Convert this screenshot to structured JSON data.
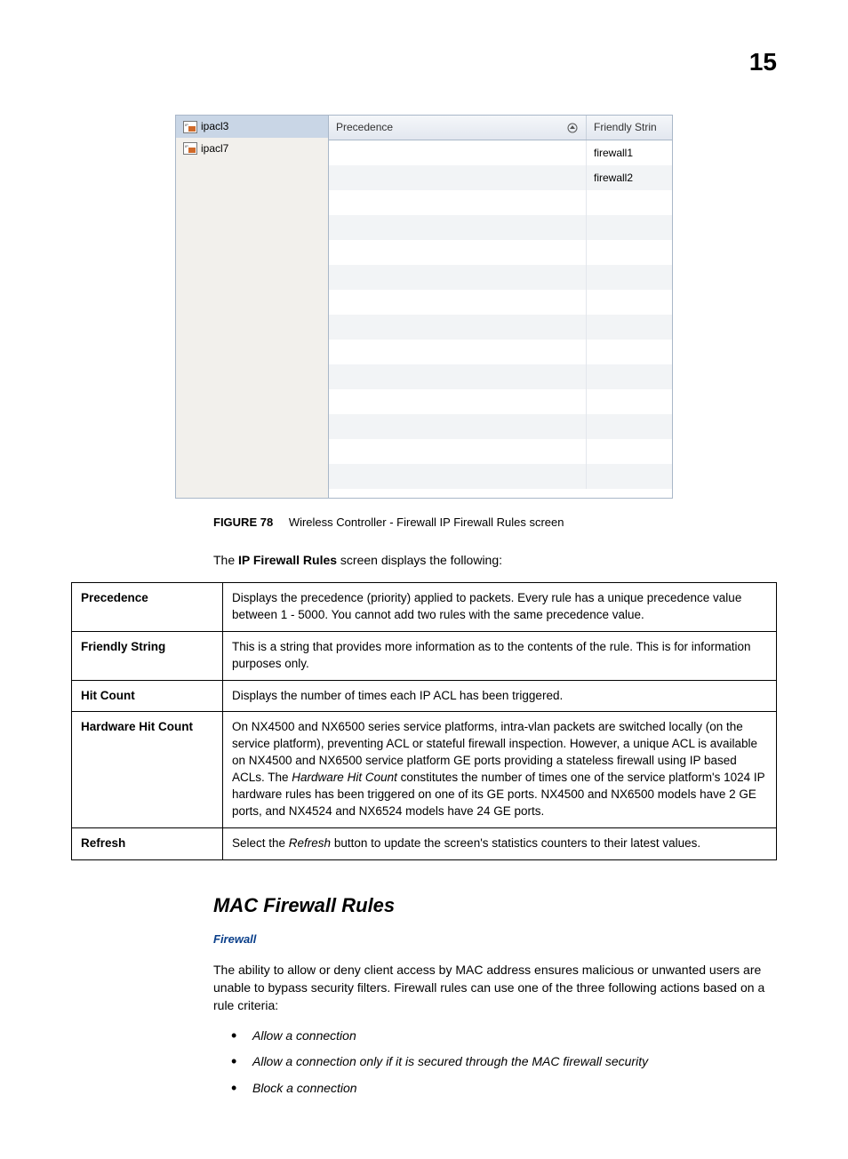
{
  "page_number": "15",
  "figure": {
    "label": "FIGURE 78",
    "title": "Wireless Controller - Firewall IP Firewall Rules screen",
    "left_items": [
      "ipacl3",
      "ipacl7"
    ],
    "headers": {
      "precedence": "Precedence",
      "friendly": "Friendly Strin"
    },
    "data_rows": [
      {
        "precedence": "",
        "friendly": "firewall1"
      },
      {
        "precedence": "",
        "friendly": "firewall2"
      }
    ]
  },
  "intro_pre": "The ",
  "intro_bold": "IP Firewall Rules",
  "intro_post": " screen displays the following:",
  "desc_rows": [
    {
      "term": "Precedence",
      "desc": "Displays the precedence (priority) applied to packets. Every rule has a unique precedence value between 1 - 5000. You cannot add two rules with the same precedence value."
    },
    {
      "term": "Friendly String",
      "desc": "This is a string that provides more information as to the contents of the rule. This is for information purposes only."
    },
    {
      "term": "Hit Count",
      "desc": "Displays the number of times each IP ACL has been triggered."
    },
    {
      "term": "Hardware Hit Count",
      "desc_pre": "On NX4500 and NX6500 series service platforms, intra-vlan packets are switched locally (on the service platform), preventing ACL or stateful firewall inspection. However, a unique ACL is available on NX4500 and NX6500 service platform GE ports providing a stateless firewall using IP based ACLs. The ",
      "desc_italic": "Hardware Hit Count",
      "desc_post": " constitutes the number of times one of the service platform's 1024 IP hardware rules has been triggered on one of its GE ports. NX4500 and NX6500 models have 2 GE ports, and NX4524 and NX6524 models have 24 GE ports."
    },
    {
      "term": "Refresh",
      "desc_pre": "Select the ",
      "desc_italic": "Refresh",
      "desc_post": " button to update the screen's statistics counters to their latest values."
    }
  ],
  "section_heading": "MAC Firewall Rules",
  "subsection_link": "Firewall",
  "body_para": "The ability to allow or deny client access by MAC address ensures malicious or unwanted users are unable to bypass security filters. Firewall rules can use one of the three following actions based on a rule criteria:",
  "bullets": [
    "Allow a connection",
    "Allow a connection only if it is secured through the MAC firewall security",
    "Block a connection"
  ]
}
